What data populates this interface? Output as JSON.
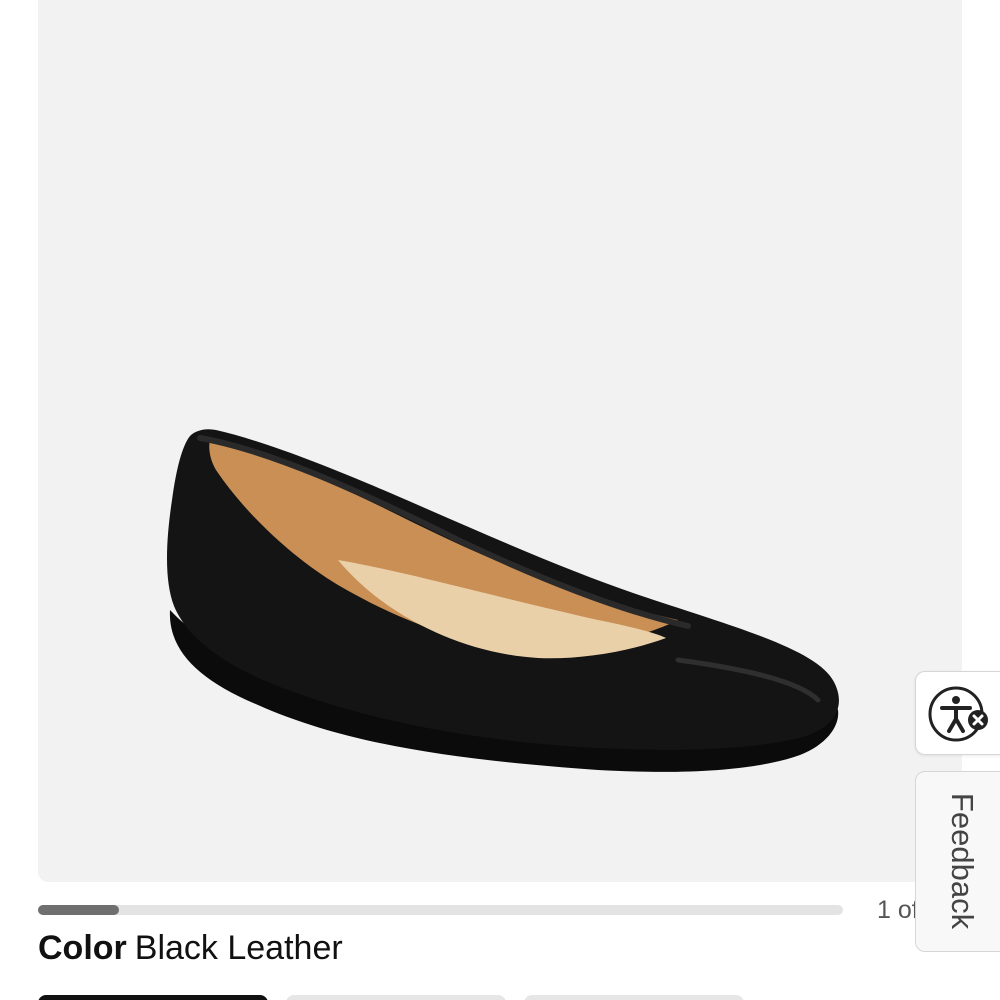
{
  "product_image": {
    "alt": "Black Leather",
    "icon": "shoe-image",
    "panel_color": "#f2f2f2",
    "shoe_color": "#111111",
    "lining_color": "#c98f55",
    "insole_color": "#ead0a8"
  },
  "carousel": {
    "progress": 0.1,
    "counter": "1 of"
  },
  "color": {
    "label": "Color",
    "value": "Black Leather"
  },
  "swatches": [
    {
      "color": "#111111",
      "selected": true
    },
    {
      "color": "#e6e6e6",
      "selected": false
    },
    {
      "color": "#e6e6e6",
      "selected": false
    }
  ],
  "accessibility": {
    "icon": "accessibility-icon",
    "close_icon": "close-icon"
  },
  "feedback": {
    "label": "Feedback"
  }
}
